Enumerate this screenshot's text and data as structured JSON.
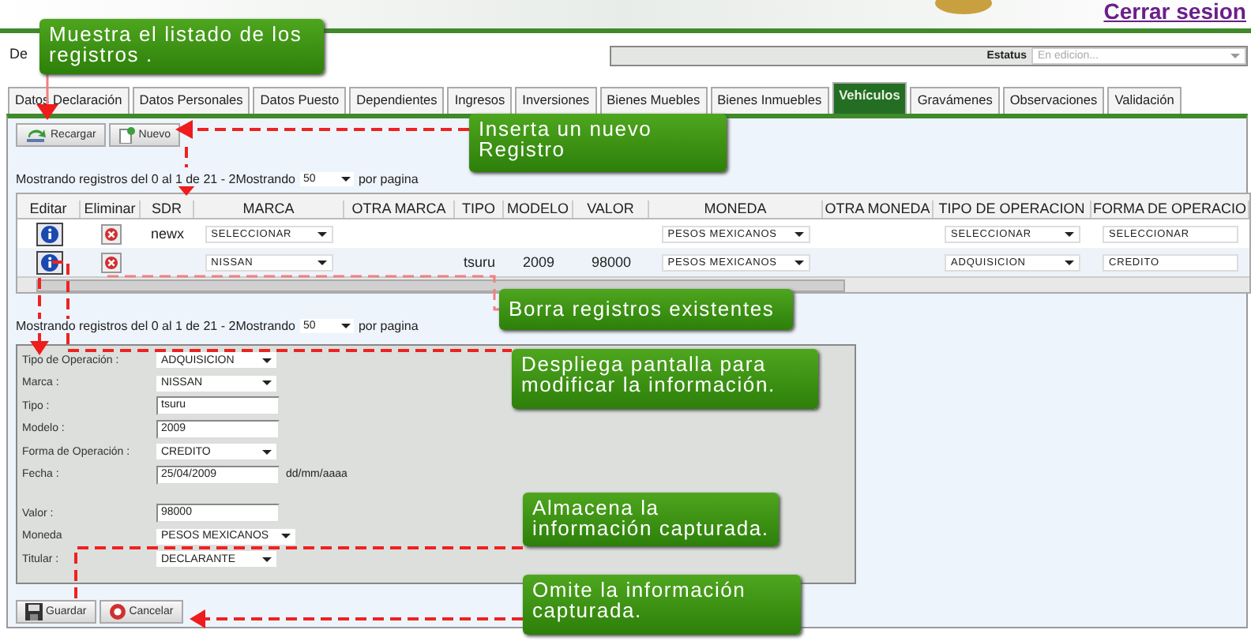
{
  "header": {
    "logout_link": "Cerrar sesion"
  },
  "declaration_label": "De",
  "status": {
    "label": "Estatus",
    "value": "En edicion..."
  },
  "tabs": [
    {
      "label": "Datos Declaración",
      "selected": false
    },
    {
      "label": "Datos Personales",
      "selected": false
    },
    {
      "label": "Datos Puesto",
      "selected": false
    },
    {
      "label": "Dependientes",
      "selected": false
    },
    {
      "label": "Ingresos",
      "selected": false
    },
    {
      "label": "Inversiones",
      "selected": false
    },
    {
      "label": "Bienes Muebles",
      "selected": false
    },
    {
      "label": "Bienes Inmuebles",
      "selected": false
    },
    {
      "label": "Vehículos",
      "selected": true
    },
    {
      "label": "Gravámenes",
      "selected": false
    },
    {
      "label": "Observaciones",
      "selected": false
    },
    {
      "label": "Validación",
      "selected": false
    }
  ],
  "toolbar": [
    {
      "label": "Recargar",
      "kind": "reload"
    },
    {
      "label": "Nuevo",
      "kind": "new"
    }
  ],
  "paging_top": {
    "text": "Mostrando registros del 0 al 1 de 21 - 2Mostrando",
    "page_size": "50",
    "suffix": "por pagina"
  },
  "table": {
    "columns": [
      "Editar",
      "Eliminar",
      "SDR",
      "MARCA",
      "OTRA MARCA",
      "TIPO",
      "MODELO",
      "VALOR",
      "MONEDA",
      "OTRA MONEDA",
      "TIPO DE OPERACION",
      "FORMA DE OPERACIO"
    ],
    "rows": [
      {
        "cells": [
          {
            "kind": "edit"
          },
          {
            "kind": "delete"
          },
          {
            "kind": "text",
            "value": "newx"
          },
          {
            "kind": "select",
            "value": "SELECCIONAR"
          },
          {
            "kind": "empty"
          },
          {
            "kind": "empty"
          },
          {
            "kind": "empty"
          },
          {
            "kind": "empty"
          },
          {
            "kind": "select",
            "value": "PESOS MEXICANOS"
          },
          {
            "kind": "empty"
          },
          {
            "kind": "select",
            "value": "SELECCIONAR"
          },
          {
            "kind": "field",
            "value": "SELECCIONAR"
          }
        ]
      },
      {
        "cells": [
          {
            "kind": "edit"
          },
          {
            "kind": "delete"
          },
          {
            "kind": "empty"
          },
          {
            "kind": "select",
            "value": "NISSAN"
          },
          {
            "kind": "empty"
          },
          {
            "kind": "text",
            "value": "tsuru"
          },
          {
            "kind": "text",
            "value": "2009"
          },
          {
            "kind": "text",
            "value": "98000"
          },
          {
            "kind": "select",
            "value": "PESOS MEXICANOS"
          },
          {
            "kind": "empty"
          },
          {
            "kind": "select",
            "value": "ADQUISICION"
          },
          {
            "kind": "field",
            "value": "CREDITO"
          }
        ]
      }
    ]
  },
  "paging_bottom": {
    "text": "Mostrando registros del 0 al 1 de 21 - 2Mostrando",
    "page_size": "50",
    "suffix": "por pagina"
  },
  "form": [
    {
      "label": "Tipo de Operación :",
      "kind": "select",
      "value": "ADQUISICION",
      "spaced": false
    },
    {
      "label": "Marca :",
      "kind": "select",
      "value": "NISSAN",
      "spaced": false
    },
    {
      "label": "Tipo :",
      "kind": "input",
      "value": "tsuru",
      "spaced": false
    },
    {
      "label": "Modelo :",
      "kind": "input",
      "value": "2009",
      "spaced": false
    },
    {
      "label": "Forma de Operación :",
      "kind": "select",
      "value": "CREDITO",
      "spaced": false
    },
    {
      "label": "Fecha :",
      "kind": "input",
      "value": "25/04/2009",
      "hint": "dd/mm/aaaa",
      "spaced": false
    },
    {
      "label": "Valor :",
      "kind": "input",
      "value": "98000",
      "spaced": true
    },
    {
      "label": "Moneda",
      "kind": "select",
      "value": "PESOS MEXICANOS",
      "spaced": false
    },
    {
      "label": "Titular :",
      "kind": "select",
      "value": "DECLARANTE",
      "spaced": false
    }
  ],
  "form_buttons": [
    {
      "label": "Guardar",
      "kind": "save"
    },
    {
      "label": "Cancelar",
      "kind": "cancel"
    }
  ],
  "callouts": [
    {
      "text": "Muestra el listado de los registros .",
      "kind": "list"
    },
    {
      "text": "Inserta un nuevo Registro",
      "kind": "insert"
    },
    {
      "text": "Borra registros existentes",
      "kind": "delete"
    },
    {
      "text": "Despliega pantalla para modificar la información.",
      "kind": "edit"
    },
    {
      "text": "Almacena la información capturada.",
      "kind": "save"
    },
    {
      "text": "Omite la información capturada.",
      "kind": "cancel"
    }
  ]
}
